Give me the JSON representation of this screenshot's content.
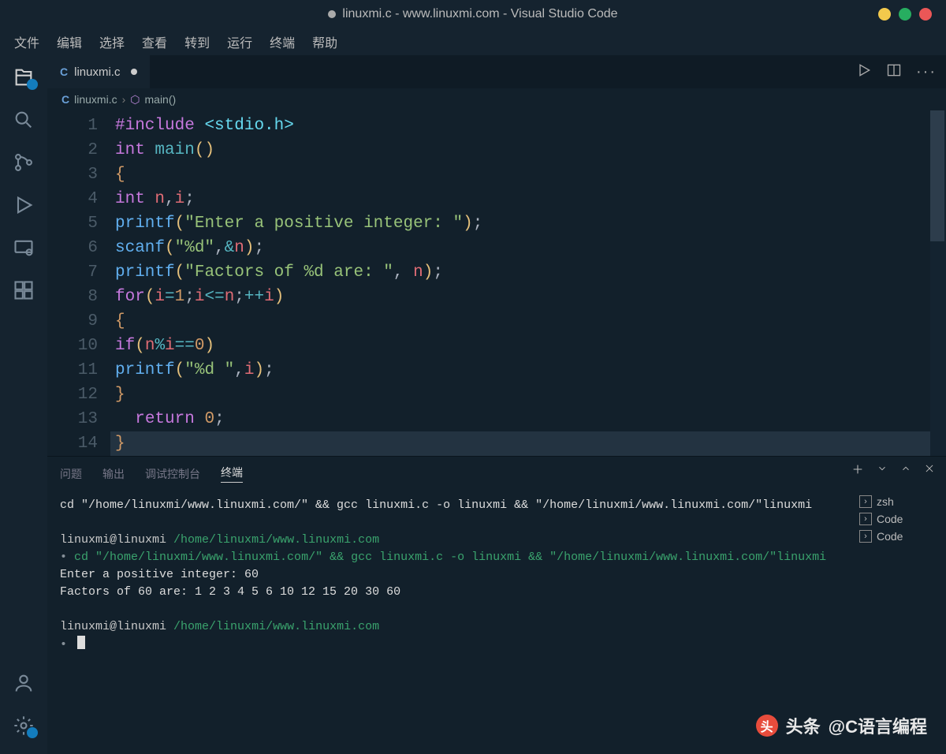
{
  "window": {
    "title": "linuxmi.c - www.linuxmi.com - Visual Studio Code"
  },
  "menubar": [
    "文件",
    "编辑",
    "选择",
    "查看",
    "转到",
    "运行",
    "终端",
    "帮助"
  ],
  "tab": {
    "lang": "C",
    "filename": "linuxmi.c",
    "modified": true
  },
  "breadcrumb": {
    "lang": "C",
    "file": "linuxmi.c",
    "symbol": "main()"
  },
  "code": {
    "lines": [
      "#include <stdio.h>",
      "int main()",
      "{",
      "int n,i;",
      "printf(\"Enter a positive integer: \");",
      "scanf(\"%d\",&n);",
      "printf(\"Factors of %d are: \", n);",
      "for(i=1;i<=n;++i)",
      "{",
      "if(n%i==0)",
      "printf(\"%d \",i);",
      "}",
      "  return 0;",
      "}"
    ],
    "highlighted_line": 14
  },
  "panel": {
    "tabs": [
      "问题",
      "输出",
      "调试控制台",
      "终端"
    ],
    "active": "终端"
  },
  "terminal": {
    "sessions": [
      "zsh",
      "Code",
      "Code"
    ],
    "lines": [
      {
        "type": "plain",
        "text": "cd \"/home/linuxmi/www.linuxmi.com/\" && gcc linuxmi.c -o linuxmi && \"/home/linuxmi/www.linuxmi.com/\"linuxmi"
      },
      {
        "type": "blank",
        "text": ""
      },
      {
        "type": "prompt",
        "user": "linuxmi@linuxmi",
        "path": "/home/linuxmi/www.linuxmi.com"
      },
      {
        "type": "cmd",
        "prefix": "•  ",
        "text": "cd \"/home/linuxmi/www.linuxmi.com/\" && gcc linuxmi.c -o linuxmi && \"/home/linuxmi/www.linuxmi.com/\"linuxmi"
      },
      {
        "type": "plain",
        "text": "Enter a positive integer: 60"
      },
      {
        "type": "plain",
        "text": "Factors of 60 are: 1 2 3 4 5 6 10 12 15 20 30 60 "
      },
      {
        "type": "blank",
        "text": ""
      },
      {
        "type": "prompt",
        "user": "linuxmi@linuxmi",
        "path": "/home/linuxmi/www.linuxmi.com"
      },
      {
        "type": "cursor",
        "prefix": "•  "
      }
    ]
  },
  "watermark": {
    "source": "头条",
    "author": "@C语言编程"
  }
}
